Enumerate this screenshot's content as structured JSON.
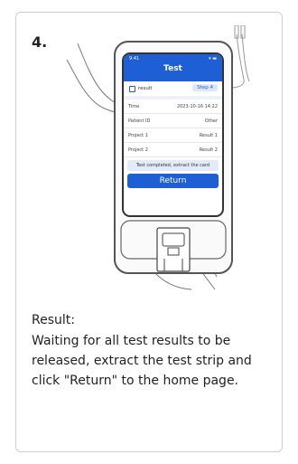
{
  "step": "4.",
  "phone": {
    "status_time": "9:41",
    "status_icons": "▾ ▬",
    "title": "Test",
    "result_label": "result",
    "step_tag": "Step 4",
    "rows": [
      {
        "label": "Time",
        "value": "2023-10-16 14:22"
      },
      {
        "label": "Patient ID",
        "value": "Other"
      },
      {
        "label": "Project 1",
        "value": "Result 1"
      },
      {
        "label": "Project 2",
        "value": "Result 2"
      }
    ],
    "message": "Test completed, extract the card",
    "return_label": "Return"
  },
  "instructions": {
    "heading": "Result:",
    "body": "Waiting for all test results to be released, extract the test strip and click \"Return\" to the home page."
  }
}
